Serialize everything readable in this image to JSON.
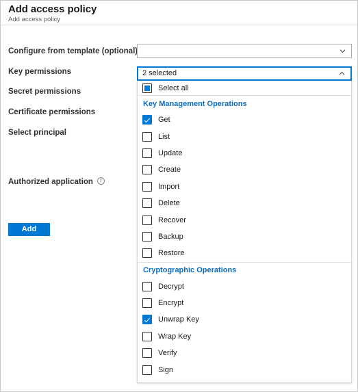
{
  "header": {
    "title": "Add access policy",
    "subtitle": "Add access policy"
  },
  "form": {
    "labels": {
      "template": "Configure from template (optional)",
      "key_permissions": "Key permissions",
      "secret_permissions": "Secret permissions",
      "certificate_permissions": "Certificate permissions",
      "select_principal": "Select principal",
      "authorized_application": "Authorized application"
    },
    "template_combo": {
      "value": "",
      "chevron": "chevron-down-icon"
    },
    "key_permissions_combo": {
      "value": "2 selected",
      "chevron": "chevron-up-icon"
    },
    "add_button_label": "Add"
  },
  "dropdown": {
    "select_all_label": "Select all",
    "select_all_state": "indeterminate",
    "groups": [
      {
        "title": "Key Management Operations",
        "options": [
          {
            "label": "Get",
            "checked": true
          },
          {
            "label": "List",
            "checked": false
          },
          {
            "label": "Update",
            "checked": false
          },
          {
            "label": "Create",
            "checked": false
          },
          {
            "label": "Import",
            "checked": false
          },
          {
            "label": "Delete",
            "checked": false
          },
          {
            "label": "Recover",
            "checked": false
          },
          {
            "label": "Backup",
            "checked": false
          },
          {
            "label": "Restore",
            "checked": false
          }
        ]
      },
      {
        "title": "Cryptographic Operations",
        "options": [
          {
            "label": "Decrypt",
            "checked": false
          },
          {
            "label": "Encrypt",
            "checked": false
          },
          {
            "label": "Unwrap Key",
            "checked": true
          },
          {
            "label": "Wrap Key",
            "checked": false
          },
          {
            "label": "Verify",
            "checked": false
          },
          {
            "label": "Sign",
            "checked": false
          }
        ]
      }
    ]
  },
  "colors": {
    "accent": "#0078d4",
    "group_header": "#0f6cbd",
    "text": "#1b1a19",
    "subtle_text": "#605e5c",
    "border": "#adadad"
  }
}
